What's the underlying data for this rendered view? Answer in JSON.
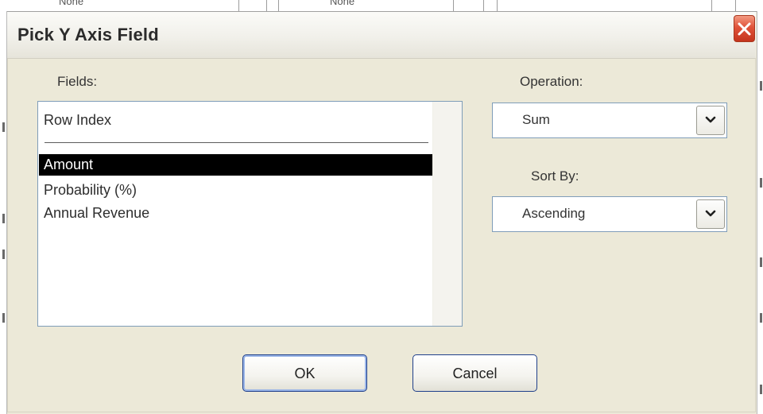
{
  "dialog": {
    "title": "Pick Y Axis Field",
    "fields_label": "Fields:",
    "fields": [
      {
        "label": "Row Index",
        "selected": false
      },
      {
        "label": "Amount",
        "selected": true
      },
      {
        "label": "Probability (%)",
        "selected": false
      },
      {
        "label": "Annual Revenue",
        "selected": false
      }
    ],
    "operation_label": "Operation:",
    "operation_value": "Sum",
    "sort_label": "Sort By:",
    "sort_value": "Ascending",
    "ok_label": "OK",
    "cancel_label": "Cancel"
  },
  "background": {
    "header_cells": [
      "None",
      "None"
    ]
  },
  "colors": {
    "selection": "#000000",
    "close_button": "#e0533a",
    "dialog_face": "#ece9d8"
  }
}
